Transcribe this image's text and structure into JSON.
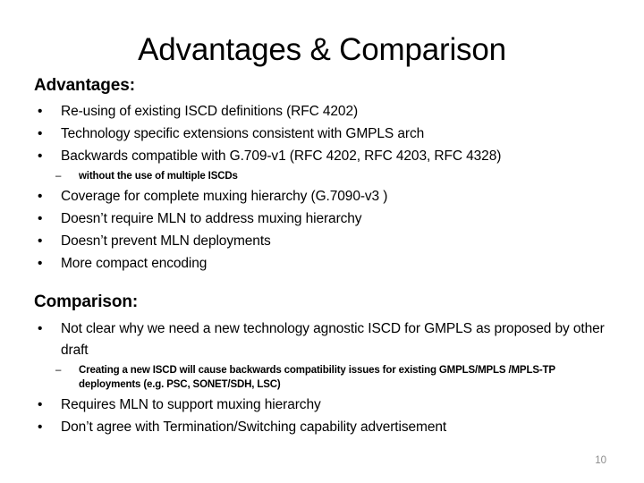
{
  "slide": {
    "title": "Advantages & Comparison",
    "number": "10",
    "number_color": "#8c8c8c",
    "background_color": "#ffffff",
    "text_color": "#000000",
    "bullet_marker": "•",
    "sub_bullet_marker": "–"
  },
  "advantages": {
    "heading": "Advantages:",
    "items": [
      "Re-using of existing ISCD definitions (RFC 4202)",
      "Technology specific extensions consistent with GMPLS arch",
      "Backwards compatible with G.709-v1 (RFC 4202, RFC 4203, RFC 4328)",
      "Coverage for complete muxing hierarchy (G.7090-v3 )",
      "Doesn’t require MLN to address muxing hierarchy",
      "Doesn’t prevent MLN deployments",
      "More compact encoding"
    ],
    "sub_item": "without the use of multiple ISCDs"
  },
  "comparison": {
    "heading": "Comparison:",
    "items": [
      "Not clear why we need a new technology agnostic ISCD for GMPLS as proposed by other draft",
      "Requires MLN to support muxing hierarchy",
      "Don’t agree with Termination/Switching capability advertisement"
    ],
    "sub_item": "Creating a new ISCD will cause backwards compatibility issues for existing GMPLS/MPLS /MPLS-TP deployments (e.g. PSC, SONET/SDH, LSC)"
  }
}
